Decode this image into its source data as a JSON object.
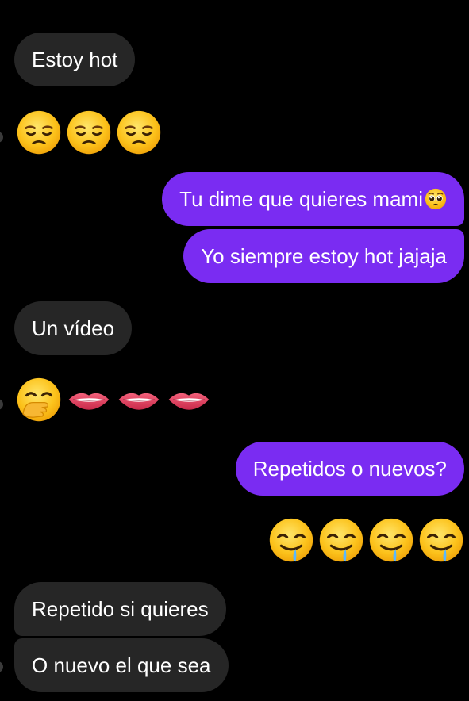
{
  "messages": {
    "m1": "Estoy hot",
    "m2_emojis": [
      "disappointed-face",
      "disappointed-face",
      "disappointed-face"
    ],
    "m3": "Tu dime que quieres mami",
    "m3_emoji": "pleading-face",
    "m4": "Yo siempre estoy hot jajaja",
    "m5": "Un vídeo",
    "m6_emojis": [
      "hand-over-mouth-face",
      "biting-lip",
      "biting-lip",
      "biting-lip"
    ],
    "m7": "Repetidos o nuevos?",
    "m8_emojis": [
      "drooling-face",
      "drooling-face",
      "drooling-face",
      "drooling-face"
    ],
    "m9": "Repetido si quieres",
    "m10": "O nuevo el que sea"
  },
  "colors": {
    "background": "#000000",
    "incoming_bubble": "#262626",
    "outgoing_bubble": "#7a2cf2",
    "text": "#ffffff"
  }
}
